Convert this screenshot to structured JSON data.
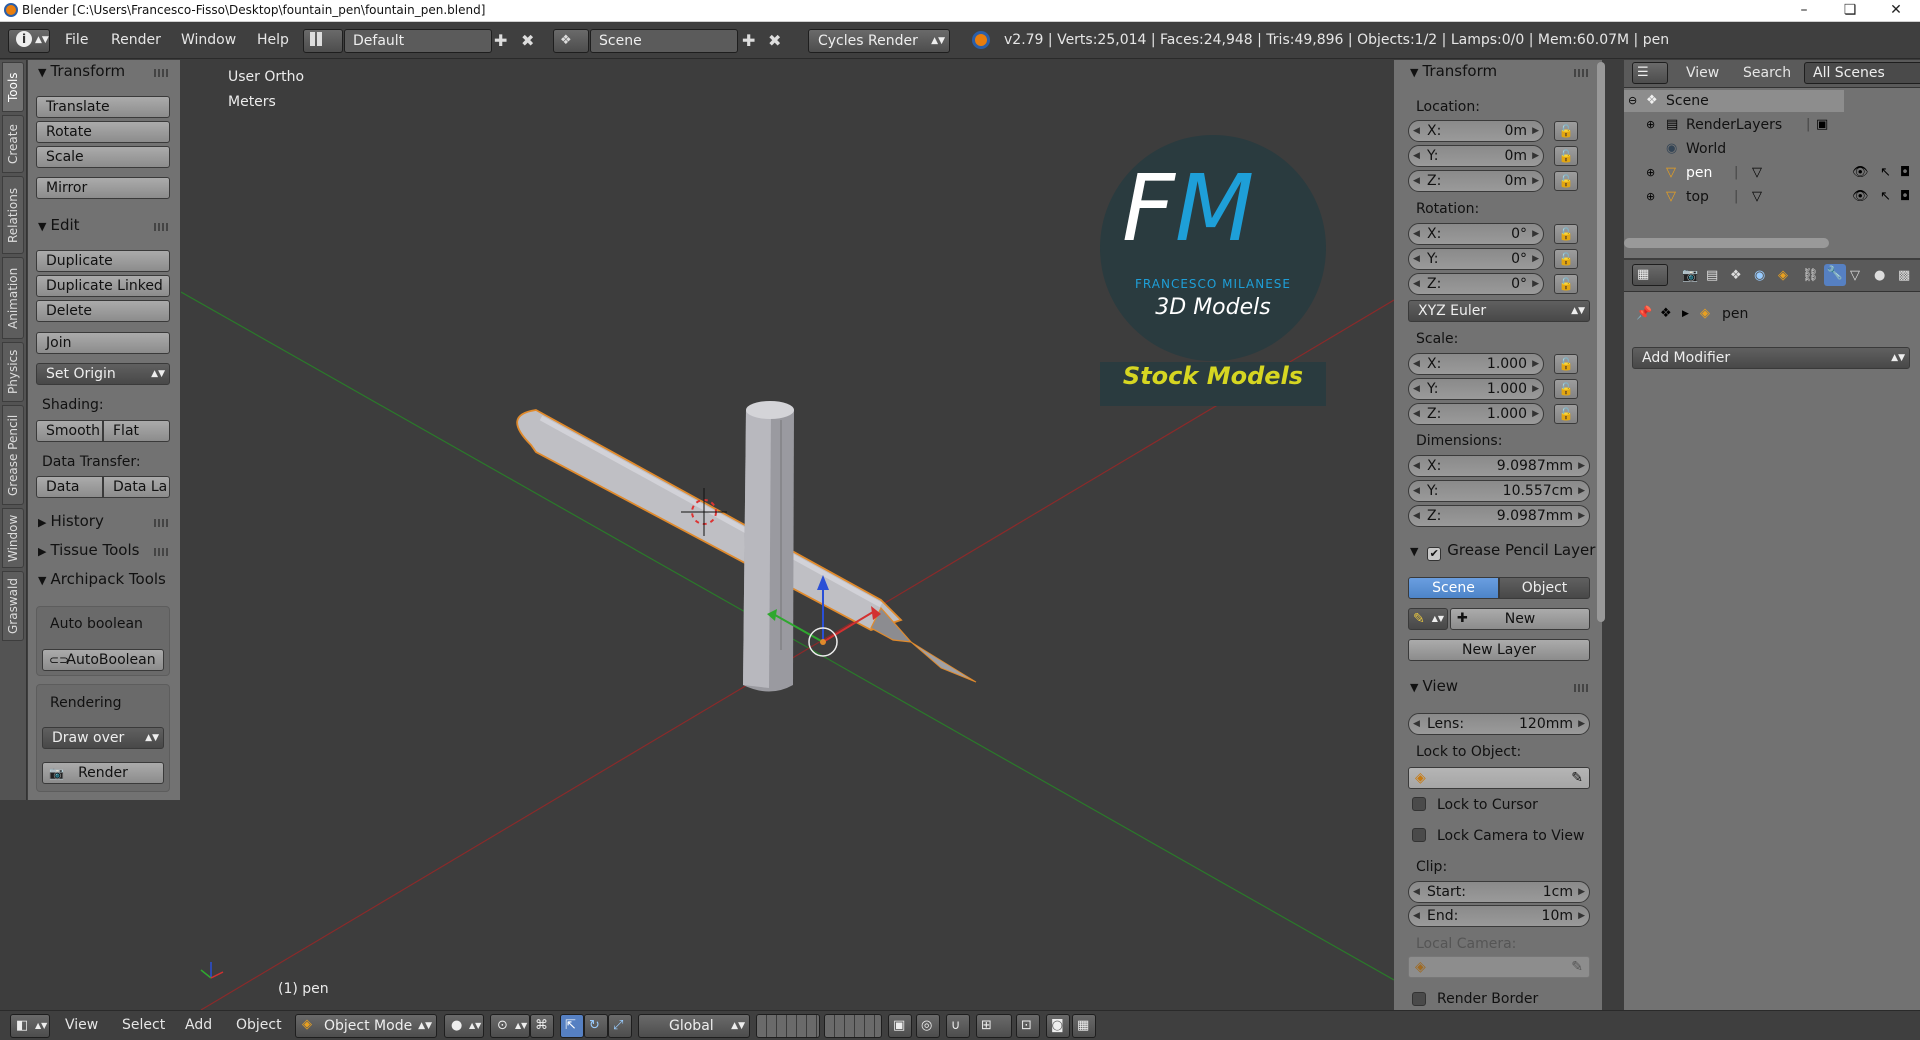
{
  "window": {
    "title": "Blender [C:\\Users\\Francesco-Fisso\\Desktop\\fountain_pen\\fountain_pen.blend]",
    "controls": [
      "–",
      "❏",
      "✕"
    ]
  },
  "infobar": {
    "menus": [
      "File",
      "Render",
      "Window",
      "Help"
    ],
    "layout": "Default",
    "scene": "Scene",
    "engine": "Cycles Render",
    "stats": "v2.79 | Verts:25,014 | Faces:24,948 | Tris:49,896 | Objects:1/2 | Lamps:0/0 | Mem:60.07M | pen"
  },
  "tool_tabs": [
    "Tools",
    "Create",
    "Relations",
    "Animation",
    "Physics",
    "Grease Pencil",
    "Window",
    "Graswald"
  ],
  "toolshelf": {
    "transform": {
      "title": "Transform",
      "buttons": [
        "Translate",
        "Rotate",
        "Scale",
        "Mirror"
      ]
    },
    "edit": {
      "title": "Edit",
      "buttons": [
        "Duplicate",
        "Duplicate Linked",
        "Delete",
        "Join"
      ],
      "set_origin": "Set Origin"
    },
    "shading": {
      "label": "Shading:",
      "smooth": "Smooth",
      "flat": "Flat"
    },
    "data_transfer": {
      "label": "Data Transfer:",
      "data": "Data",
      "data_layers": "Data La"
    },
    "history": "History",
    "tissue": "Tissue Tools",
    "archipack": "Archipack Tools",
    "auto_boolean": {
      "label": "Auto boolean",
      "button": "AutoBoolean"
    },
    "rendering": {
      "label": "Rendering",
      "draw_over": "Draw over",
      "render": "Render"
    }
  },
  "viewport": {
    "view_name": "User Ortho",
    "units": "Meters",
    "object_label": "(1) pen",
    "logo": {
      "initials_f": "F",
      "initials_m": "M",
      "name": "FRANCESCO MILANESE",
      "subtitle": "3D Models",
      "banner": "Stock Models"
    }
  },
  "npanel": {
    "transform_title": "Transform",
    "location_label": "Location:",
    "location": [
      {
        "k": "X:",
        "v": "0m"
      },
      {
        "k": "Y:",
        "v": "0m"
      },
      {
        "k": "Z:",
        "v": "0m"
      }
    ],
    "rotation_label": "Rotation:",
    "rotation": [
      {
        "k": "X:",
        "v": "0°"
      },
      {
        "k": "Y:",
        "v": "0°"
      },
      {
        "k": "Z:",
        "v": "0°"
      }
    ],
    "rotation_mode": "XYZ Euler",
    "scale_label": "Scale:",
    "scale": [
      {
        "k": "X:",
        "v": "1.000"
      },
      {
        "k": "Y:",
        "v": "1.000"
      },
      {
        "k": "Z:",
        "v": "1.000"
      }
    ],
    "dimensions_label": "Dimensions:",
    "dimensions": [
      {
        "k": "X:",
        "v": "9.0987mm"
      },
      {
        "k": "Y:",
        "v": "10.557cm"
      },
      {
        "k": "Z:",
        "v": "9.0987mm"
      }
    ],
    "grease_pencil": {
      "title": "Grease Pencil Layer",
      "scene": "Scene",
      "object": "Object",
      "new": "New",
      "new_layer": "New Layer"
    },
    "view": {
      "title": "View",
      "lens_k": "Lens:",
      "lens_v": "120mm",
      "lock_to_object": "Lock to Object:",
      "lock_to_cursor": "Lock to Cursor",
      "lock_camera": "Lock Camera to View",
      "clip": "Clip:",
      "start_k": "Start:",
      "start_v": "1cm",
      "end_k": "End:",
      "end_v": "10m",
      "local_camera": "Local Camera:",
      "render_border": "Render Border"
    }
  },
  "outliner": {
    "menus": [
      "View",
      "Search"
    ],
    "filter": "All Scenes",
    "items": [
      {
        "label": "Scene"
      },
      {
        "label": "RenderLayers"
      },
      {
        "label": "World"
      },
      {
        "label": "pen"
      },
      {
        "label": "top"
      }
    ]
  },
  "properties": {
    "object_name": "pen",
    "add_modifier": "Add Modifier"
  },
  "statusbar": {
    "menus": [
      "View",
      "Select",
      "Add",
      "Object"
    ],
    "mode": "Object Mode",
    "orientation": "Global"
  },
  "colors": {
    "accent_blue": "#5680c2",
    "logo_blue": "#1e9fd8",
    "logo_yellow": "#d6d622",
    "selection_orange": "#e08a2c",
    "axis_x": "#d33030",
    "axis_y": "#2fa82f"
  }
}
